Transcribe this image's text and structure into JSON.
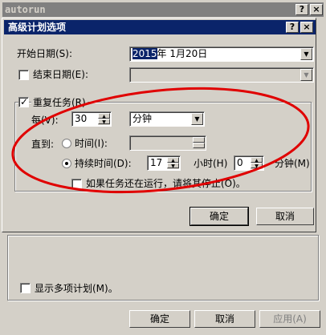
{
  "outer_window": {
    "title": "autorun",
    "help_btn": "?",
    "close_btn": "×",
    "show_multiple_label": "显示多项计划(M)。",
    "ok_label": "确定",
    "cancel_label": "取消",
    "apply_label": "应用(A)"
  },
  "dialog": {
    "title": "高级计划选项",
    "help_btn": "?",
    "close_btn": "×",
    "start_date_label": "开始日期(S):",
    "start_date_year": "2015",
    "start_date_rest": "年 1月20日",
    "end_date_label": "结束日期(E):",
    "end_date_checked": false,
    "end_date_value": "",
    "repeat_task_label": "重复任务(R)",
    "repeat_task_checked": true,
    "every_label": "每(V):",
    "every_value": "30",
    "unit_value": "分钟",
    "until_label": "直到:",
    "time_label": "时间(I):",
    "time_selected": false,
    "time_value": "",
    "duration_label": "持续时间(D):",
    "duration_selected": true,
    "hours_value": "17",
    "hours_label": "小时(H)",
    "minutes_value": "0",
    "minutes_label": "分钟(M)",
    "stop_if_running_label": "如果任务还在运行，请将其停止(O)。",
    "stop_if_running_checked": false,
    "ok_label": "确定",
    "cancel_label": "取消"
  },
  "colors": {
    "annotation": "#e00000",
    "active_title": "#0a246a",
    "inactive_title": "#808080",
    "face": "#d4d0c8"
  }
}
